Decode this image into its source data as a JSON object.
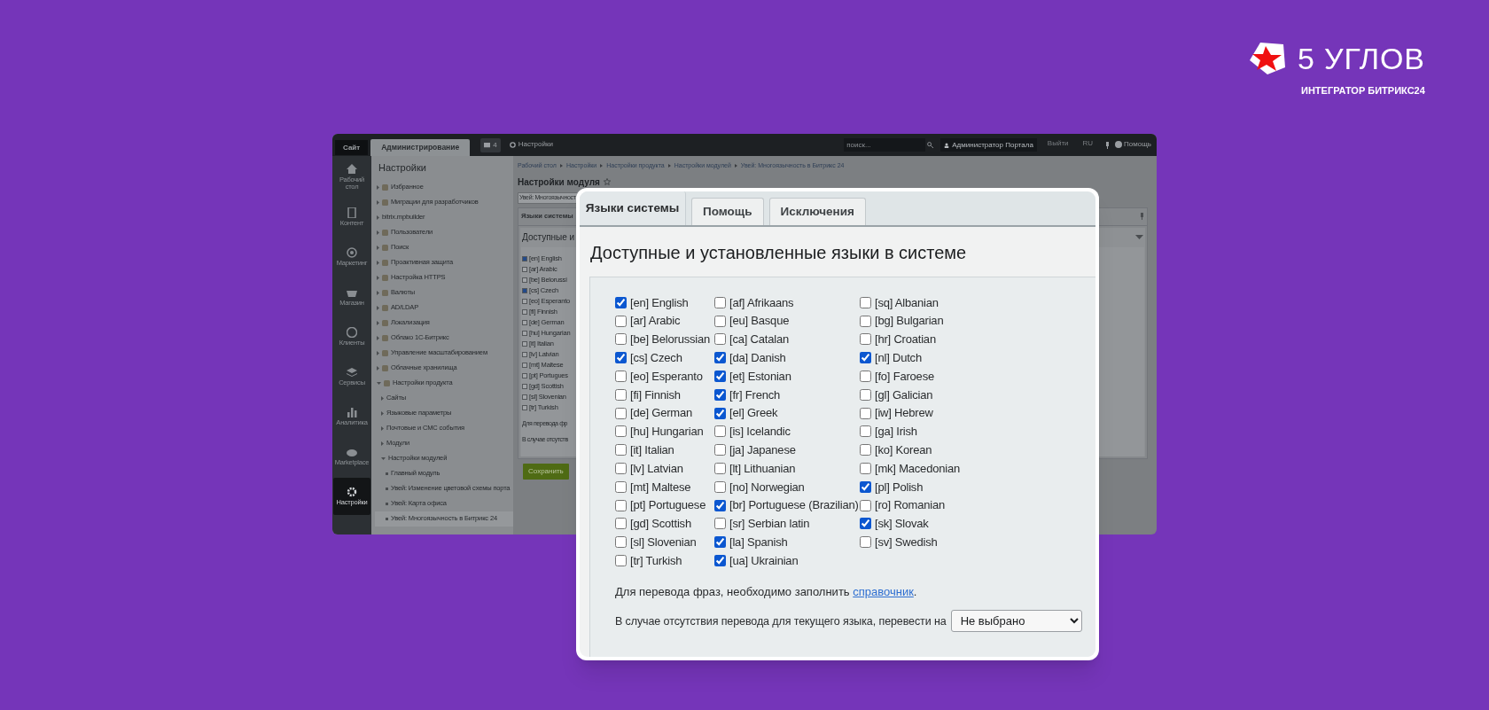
{
  "logo": {
    "name": "5 УГЛОВ",
    "tagline": "ИНТЕГРАТОР БИТРИКС24"
  },
  "background_screen": {
    "top_bar": {
      "tabs": [
        {
          "label": "Сайт",
          "selected": false
        },
        {
          "label": "Администрирование",
          "selected": true
        }
      ],
      "notifications": "4",
      "settings": "Настройки",
      "search": {
        "placeholder": "поиск..."
      },
      "user": "Администратор Портала",
      "logout": "Выйти",
      "language": "RU",
      "help": "Помощь"
    },
    "left_nav": [
      {
        "label": "Рабочий стол",
        "selected": false
      },
      {
        "label": "Контент",
        "selected": false
      },
      {
        "label": "Маркетинг",
        "selected": false
      },
      {
        "label": "Магазин",
        "selected": false
      },
      {
        "label": "Клиенты",
        "selected": false
      },
      {
        "label": "Сервисы",
        "selected": false
      },
      {
        "label": "Аналитика",
        "selected": false
      },
      {
        "label": "Marketplace",
        "selected": false
      },
      {
        "label": "Настройки",
        "selected": true
      }
    ],
    "sidebar": {
      "title": "Настройки",
      "items": [
        {
          "label": "Избранное",
          "has_icon": true,
          "expanded": false
        },
        {
          "label": "Миграции для разработчиков",
          "has_icon": true,
          "expanded": false
        },
        {
          "label": "bitrix.mpbuilder",
          "has_icon": false,
          "expanded": false
        },
        {
          "label": "Пользователи",
          "has_icon": true,
          "expanded": false
        },
        {
          "label": "Поиск",
          "has_icon": true,
          "expanded": false
        },
        {
          "label": "Проактивная защита",
          "has_icon": true,
          "expanded": false
        },
        {
          "label": "Настройка HTTPS",
          "has_icon": true,
          "expanded": false
        },
        {
          "label": "Валюты",
          "has_icon": true,
          "expanded": false
        },
        {
          "label": "AD/LDAP",
          "has_icon": true,
          "expanded": false
        },
        {
          "label": "Локализация",
          "has_icon": true,
          "expanded": false
        },
        {
          "label": "Облако 1С-Битрикс",
          "has_icon": true,
          "expanded": false
        },
        {
          "label": "Управление масштабированием",
          "has_icon": true,
          "expanded": false
        },
        {
          "label": "Облачные хранилища",
          "has_icon": true,
          "expanded": false
        },
        {
          "label": "Настройки продукта",
          "has_icon": true,
          "expanded": true,
          "children": [
            {
              "label": "Сайты",
              "expanded": false
            },
            {
              "label": "Языковые параметры",
              "expanded": false
            },
            {
              "label": "Почтовые и СМС события",
              "expanded": false
            },
            {
              "label": "Модули",
              "expanded": false
            },
            {
              "label": "Настройки модулей",
              "expanded": true,
              "children": [
                {
                  "label": "Главный модуль",
                  "selected": false
                },
                {
                  "label": "Увей: Изменение цветовой схемы порта",
                  "selected": false
                },
                {
                  "label": "Увей: Карта офиса",
                  "selected": false
                },
                {
                  "label": "Увей: Многоязычность в Битрикс 24",
                  "selected": true
                }
              ]
            }
          ]
        }
      ]
    },
    "breadcrumbs": [
      "Рабочий стол",
      "Настройки",
      "Настройки продукта",
      "Настройки модулей",
      "Увей: Многоязычность в Битрикс 24"
    ],
    "title": "Настройки модуля",
    "module_select": {
      "value": "Увей: Многоязычност"
    },
    "tab": "Языки системы",
    "section_title": "Доступные и",
    "languages": [
      {
        "label": "[en] English",
        "checked": true
      },
      {
        "label": "[ar] Arabic",
        "checked": false
      },
      {
        "label": "[be] Belorussi",
        "checked": false
      },
      {
        "label": "[cs] Czech",
        "checked": true
      },
      {
        "label": "[eo] Esperanto",
        "checked": false
      },
      {
        "label": "[fi] Finnish",
        "checked": false
      },
      {
        "label": "[de] German",
        "checked": false
      },
      {
        "label": "[hu] Hungarian",
        "checked": false
      },
      {
        "label": "[it] Italian",
        "checked": false
      },
      {
        "label": "[lv] Latvian",
        "checked": false
      },
      {
        "label": "[mt] Maltese",
        "checked": false
      },
      {
        "label": "[pt] Portugues",
        "checked": false
      },
      {
        "label": "[gd] Scottish",
        "checked": false
      },
      {
        "label": "[sl] Slovenian",
        "checked": false
      },
      {
        "label": "[tr] Turkish",
        "checked": false
      }
    ],
    "notes": [
      "Для перевода фр",
      "В случае отсутств"
    ],
    "save_button": "Сохранить"
  },
  "dialog": {
    "tabs": [
      {
        "label": "Языки системы",
        "selected": true
      },
      {
        "label": "Помощь",
        "selected": false
      },
      {
        "label": "Исключения",
        "selected": false
      }
    ],
    "title": "Доступные и установленные языки в системе",
    "columns": [
      [
        {
          "label": "[en] English",
          "checked": true
        },
        {
          "label": "[ar] Arabic",
          "checked": false
        },
        {
          "label": "[be] Belorussian",
          "checked": false
        },
        {
          "label": "[cs] Czech",
          "checked": true
        },
        {
          "label": "[eo] Esperanto",
          "checked": false
        },
        {
          "label": "[fi] Finnish",
          "checked": false
        },
        {
          "label": "[de] German",
          "checked": false
        },
        {
          "label": "[hu] Hungarian",
          "checked": false
        },
        {
          "label": "[it] Italian",
          "checked": false
        },
        {
          "label": "[lv] Latvian",
          "checked": false
        },
        {
          "label": "[mt] Maltese",
          "checked": false
        },
        {
          "label": "[pt] Portuguese",
          "checked": false
        },
        {
          "label": "[gd] Scottish",
          "checked": false
        },
        {
          "label": "[sl] Slovenian",
          "checked": false
        },
        {
          "label": "[tr] Turkish",
          "checked": false
        }
      ],
      [
        {
          "label": "[af] Afrikaans",
          "checked": false
        },
        {
          "label": "[eu] Basque",
          "checked": false
        },
        {
          "label": "[ca] Catalan",
          "checked": false
        },
        {
          "label": "[da] Danish",
          "checked": true
        },
        {
          "label": "[et] Estonian",
          "checked": true
        },
        {
          "label": "[fr] French",
          "checked": true
        },
        {
          "label": "[el] Greek",
          "checked": true
        },
        {
          "label": "[is] Icelandic",
          "checked": false
        },
        {
          "label": "[ja] Japanese",
          "checked": false
        },
        {
          "label": "[lt] Lithuanian",
          "checked": false
        },
        {
          "label": "[no] Norwegian",
          "checked": false
        },
        {
          "label": "[br] Portuguese (Brazilian)",
          "checked": true
        },
        {
          "label": "[sr] Serbian latin",
          "checked": false
        },
        {
          "label": "[la] Spanish",
          "checked": true
        },
        {
          "label": "[ua] Ukrainian",
          "checked": true
        }
      ],
      [
        {
          "label": "[sq] Albanian",
          "checked": false
        },
        {
          "label": "[bg] Bulgarian",
          "checked": false
        },
        {
          "label": "[hr] Croatian",
          "checked": false
        },
        {
          "label": "[nl] Dutch",
          "checked": true
        },
        {
          "label": "[fo] Faroese",
          "checked": false
        },
        {
          "label": "[gl] Galician",
          "checked": false
        },
        {
          "label": "[iw] Hebrew",
          "checked": false
        },
        {
          "label": "[ga] Irish",
          "checked": false
        },
        {
          "label": "[ko] Korean",
          "checked": false
        },
        {
          "label": "[mk] Macedonian",
          "checked": false
        },
        {
          "label": "[pl] Polish",
          "checked": true
        },
        {
          "label": "[ro] Romanian",
          "checked": false
        },
        {
          "label": "[sk] Slovak",
          "checked": true
        },
        {
          "label": "[sv] Swedish",
          "checked": false
        }
      ]
    ],
    "note": {
      "text": "Для перевода фраз, необходимо заполнить ",
      "link": "справочник",
      "tail": "."
    },
    "fallback": {
      "label": "В случае отсутствия перевода для текущего языка, перевести на",
      "value": "Не выбрано"
    }
  }
}
